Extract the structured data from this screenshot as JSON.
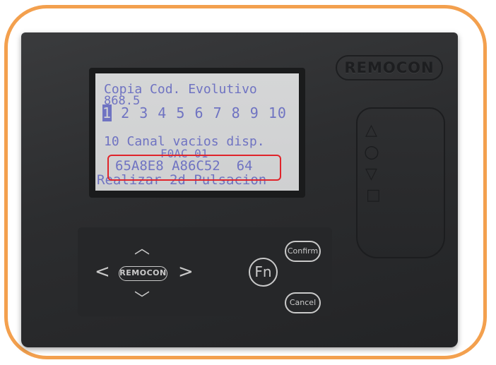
{
  "device": {
    "brand_logo": "REMOCON",
    "nav_logo": "REMOCON"
  },
  "lcd": {
    "line1": "Copia Cod. Evolutivo",
    "line2": "868.5",
    "numbers": [
      "1",
      "2",
      "3",
      "4",
      "5",
      "6",
      "7",
      "8",
      "9",
      "10"
    ],
    "selected_number": "1",
    "line4": "10 Canal vacios disp.",
    "line5": "F0AC 01",
    "line6": "65A8E8 A86C52  64",
    "line7": "Realizar 2d Pulsacion"
  },
  "buttons": {
    "fn": "Fn",
    "confirm": "Confirm",
    "cancel": "Cancel"
  },
  "colors": {
    "frame": "#f3a04e",
    "highlight": "#e0242a",
    "lcd_text": "#6f73c2",
    "lcd_background": "#d2d3d4"
  }
}
